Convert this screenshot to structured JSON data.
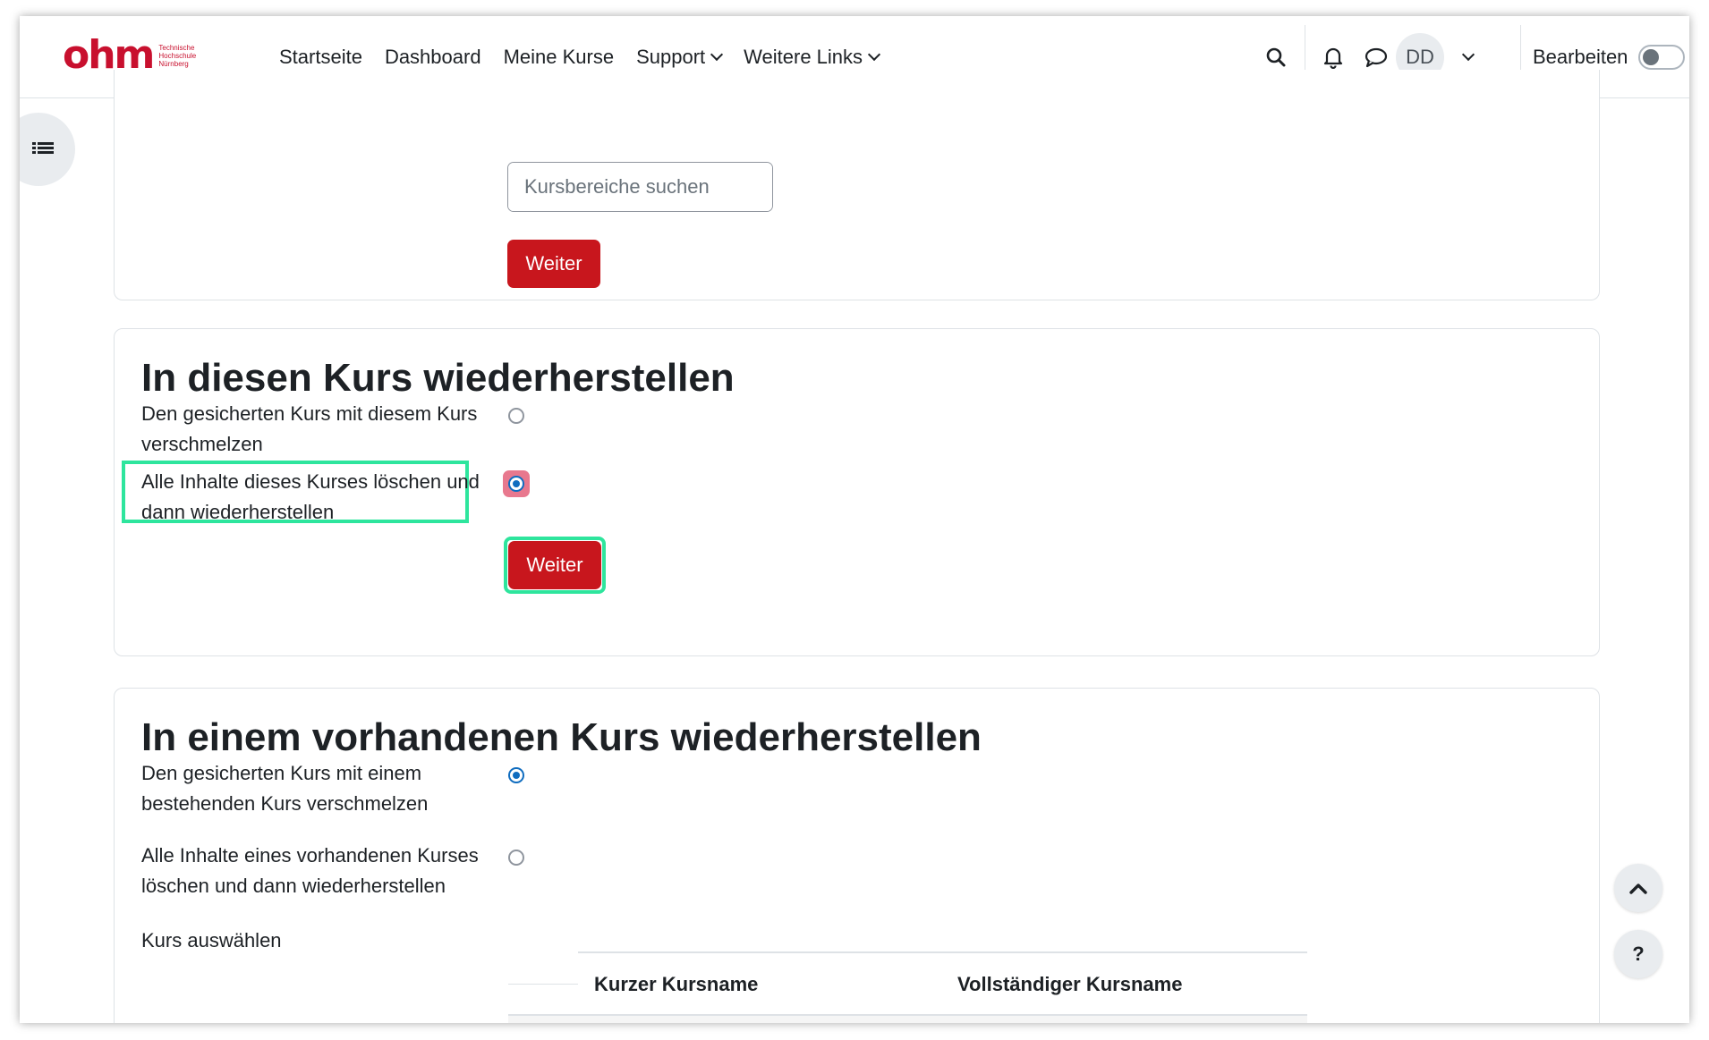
{
  "logo": {
    "mark": "ohm",
    "subtitle": [
      "Technische",
      "Hochschule",
      "Nürnberg"
    ]
  },
  "nav": {
    "items": [
      "Startseite",
      "Dashboard",
      "Meine Kurse",
      "Support",
      "Weitere Links"
    ],
    "avatar_initials": "DD",
    "edit_label": "Bearbeiten",
    "edit_toggle_on": false
  },
  "search_section": {
    "placeholder": "Kursbereiche suchen",
    "button_label": "Weiter"
  },
  "restore_this": {
    "title": "In diesen Kurs wiederherstellen",
    "option1": "Den gesicherten Kurs mit diesem Kurs verschmelzen",
    "option1_checked": false,
    "option2": "Alle Inhalte dieses Kurses löschen und dann wiederherstellen",
    "option2_checked": true,
    "button_label": "Weiter"
  },
  "restore_existing": {
    "title": "In einem vorhandenen Kurs wiederherstellen",
    "option1": "Den gesicherten Kurs mit einem bestehenden Kurs verschmelzen",
    "option1_checked": true,
    "option2": "Alle Inhalte eines vorhandenen Kurses löschen und dann wiederherstellen",
    "option2_checked": false,
    "select_label": "Kurs auswählen",
    "table_headers": [
      "",
      "Kurzer Kursname",
      "Vollständiger Kursname"
    ]
  },
  "floating": {
    "help_label": "?"
  },
  "colors": {
    "brand": "#c8102e",
    "primary_button": "#c8161d",
    "highlight": "#2ee59d",
    "radio_checked": "#0f6cbf"
  }
}
